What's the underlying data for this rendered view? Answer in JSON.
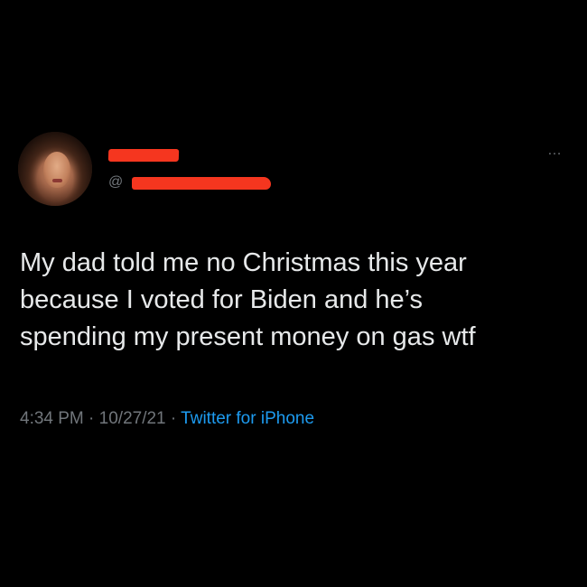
{
  "tweet": {
    "author": {
      "handle_prefix": "@",
      "avatar_icon": "user-avatar"
    },
    "more_icon": "…",
    "body_lines": [
      "My dad told me no Christmas this year",
      "because I voted for Biden and he’s",
      "spending my present money on gas wtf"
    ],
    "meta": {
      "time": "4:34 PM",
      "separator": "·",
      "date": "10/27/21",
      "source": "Twitter for iPhone"
    }
  },
  "colors": {
    "background": "#000000",
    "text": "#e7e9ea",
    "secondary": "#71767b",
    "link": "#1d9bf0",
    "redaction": "#f5361f"
  }
}
